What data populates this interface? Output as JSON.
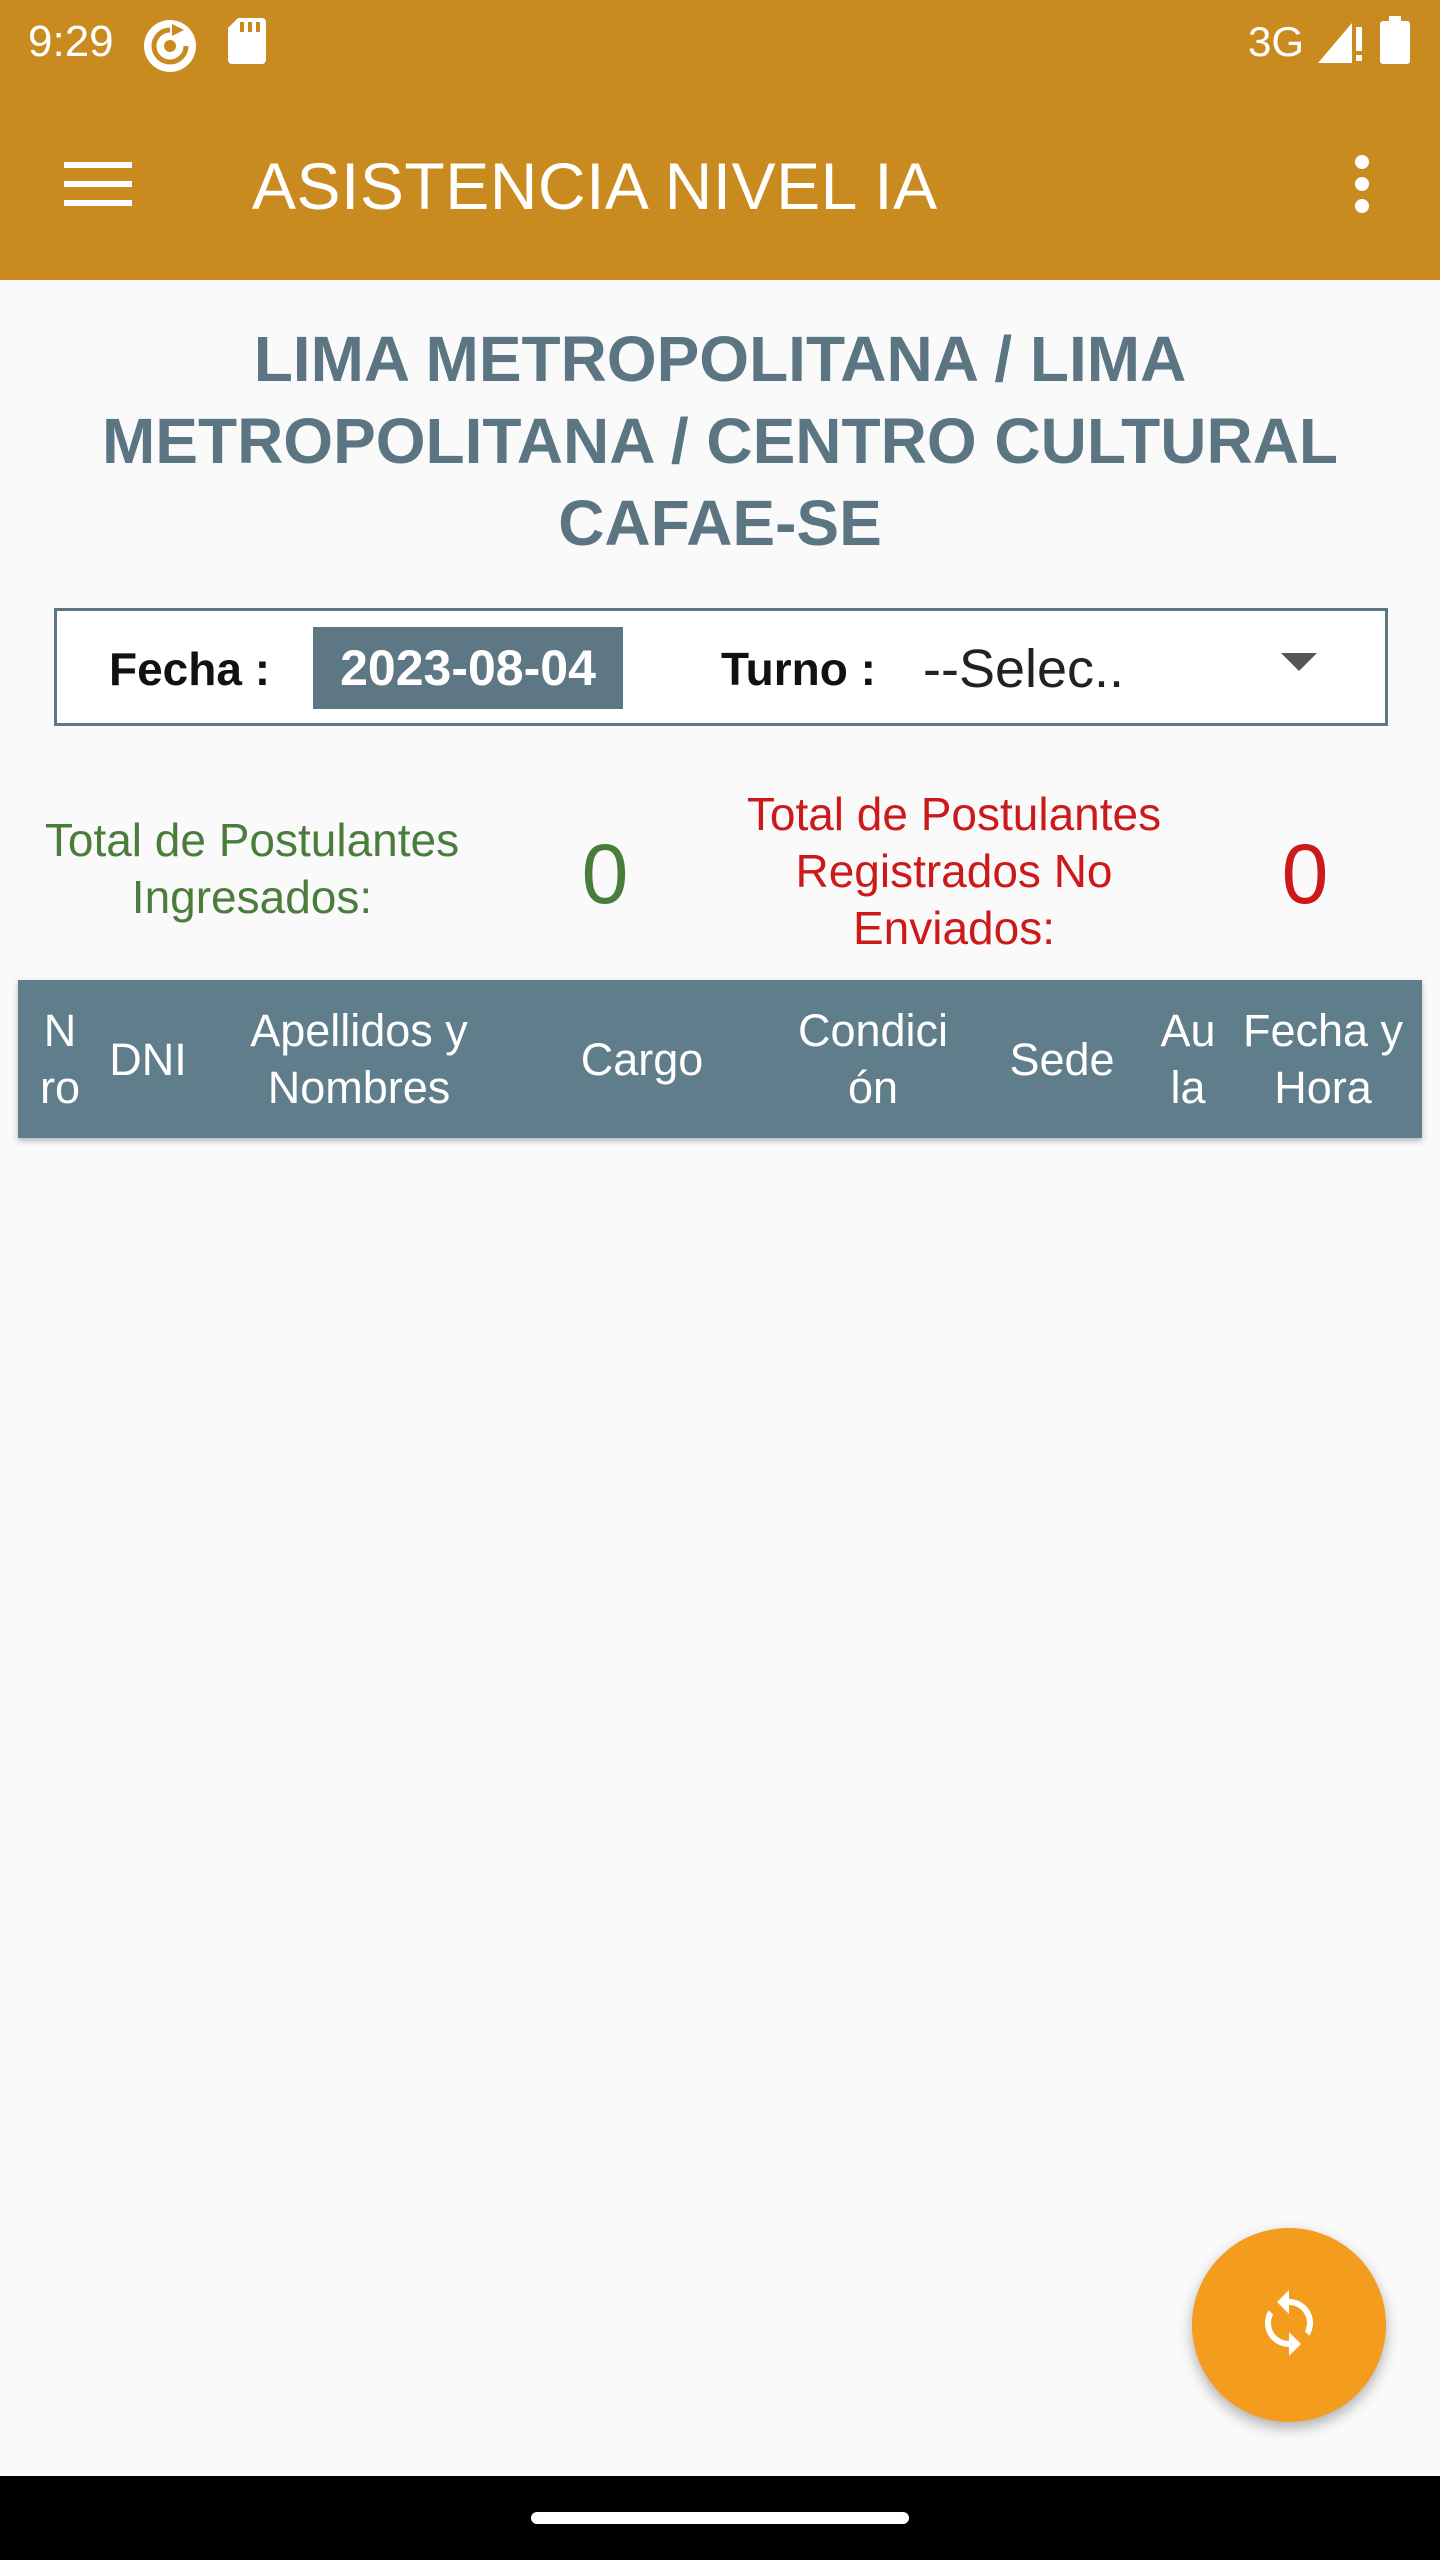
{
  "status_bar": {
    "time": "9:29",
    "left_icons": [
      "sync-app-icon",
      "sd-card-icon"
    ],
    "network": "3G",
    "right_icons": [
      "signal-icon",
      "battery-icon"
    ]
  },
  "toolbar": {
    "menu_icon": "hamburger-menu-icon",
    "title": "ASISTENCIA NIVEL IA",
    "overflow_icon": "more-vert-icon",
    "color": "#c98a1f"
  },
  "location_title": {
    "line1": "LIMA METROPOLITANA / LIMA",
    "line2": "METROPOLITANA / CENTRO CULTURAL",
    "line3": "CAFAE-SE"
  },
  "filters": {
    "fecha_label": "Fecha :",
    "fecha_value": "2023-08-04",
    "turno_label": "Turno :",
    "turno_value": "--Selec..",
    "turno_icon": "dropdown-arrow-icon"
  },
  "counters": {
    "ingresados": {
      "line1": "Total de Postulantes",
      "line2": "Ingresados:",
      "value": "0",
      "color": "#4a7d3c"
    },
    "no_enviados": {
      "line1": "Total de Postulantes",
      "line2": "Registrados No",
      "line3": "Enviados:",
      "value": "0",
      "color": "#cc1a1a"
    }
  },
  "table": {
    "header_color": "#607d8b",
    "columns": [
      {
        "line1": "N",
        "line2": "ro"
      },
      {
        "line1": "DNI",
        "line2": ""
      },
      {
        "line1": "Apellidos y",
        "line2": "Nombres"
      },
      {
        "line1": "Cargo",
        "line2": ""
      },
      {
        "line1": "Condici",
        "line2": "ón"
      },
      {
        "line1": "Sede",
        "line2": ""
      },
      {
        "line1": "Au",
        "line2": "la"
      },
      {
        "line1": "Fecha y",
        "line2": "Hora"
      }
    ],
    "rows": []
  },
  "fab": {
    "icon": "refresh-sync-icon",
    "color": "#f39c1e"
  }
}
